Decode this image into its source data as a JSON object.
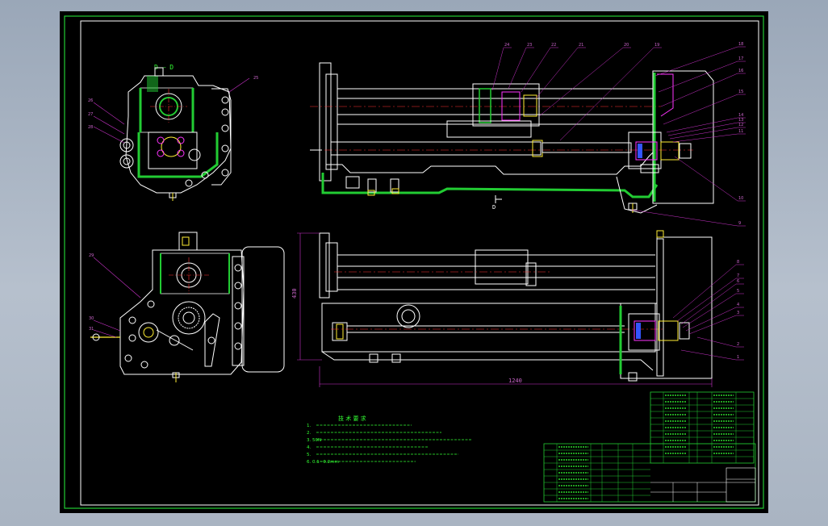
{
  "colors": {
    "background": "#000000",
    "frame": "#22cc33",
    "outline": "#ffffff",
    "hatch": "#22cc33",
    "centerline": "#ff3333",
    "leader": "#cc33cc",
    "part_number": "#cc66cc",
    "notes": "#33ff33",
    "parts_blue": "#3355ff",
    "parts_magenta": "#ff33ff",
    "parts_yellow": "#ffee33"
  },
  "section_label": "D — D",
  "section_arrow_label": "D",
  "dimensions": {
    "height": "430",
    "length": "1240"
  },
  "callouts_top": [
    "24",
    "23",
    "22",
    "21",
    "20",
    "19",
    "18",
    "17",
    "16",
    "15",
    "14",
    "13",
    "12",
    "11",
    "10",
    "9"
  ],
  "callouts_bottom": [
    "8",
    "7",
    "6",
    "5",
    "4",
    "3",
    "2",
    "1"
  ],
  "callouts_left": [
    "25",
    "26",
    "27",
    "28",
    "29",
    "30",
    "31"
  ],
  "tech_requirements": {
    "title": "技 术 要 求",
    "lines": [
      "1.",
      "2.",
      "3. 50N",
      "4.",
      "5.",
      "6. 0.1~0.2mm"
    ]
  }
}
